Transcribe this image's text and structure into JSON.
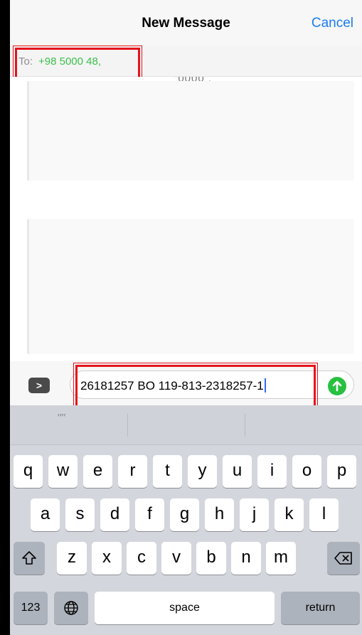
{
  "header": {
    "title": "New Message",
    "cancel_label": "Cancel"
  },
  "to_field": {
    "label": "To:",
    "value": "+98 5000 48,"
  },
  "conversation": {
    "partial_text": "\"0000 ."
  },
  "composer": {
    "apps_glyph": ">",
    "message_text": "26181257 BO 119-813-2318257-1"
  },
  "keyboard": {
    "prediction_quote": "\"\"",
    "row1": [
      "q",
      "w",
      "e",
      "r",
      "t",
      "y",
      "u",
      "i",
      "o",
      "p"
    ],
    "row2": [
      "a",
      "s",
      "d",
      "f",
      "g",
      "h",
      "j",
      "k",
      "l"
    ],
    "row3": [
      "z",
      "x",
      "c",
      "v",
      "b",
      "n",
      "m"
    ],
    "numbers_label": "123",
    "space_label": "space",
    "return_label": "return"
  },
  "colors": {
    "accent_blue": "#1a7cf5",
    "recipient_green": "#3cc04a",
    "send_green": "#27c13f",
    "highlight_red": "#e5141c"
  }
}
